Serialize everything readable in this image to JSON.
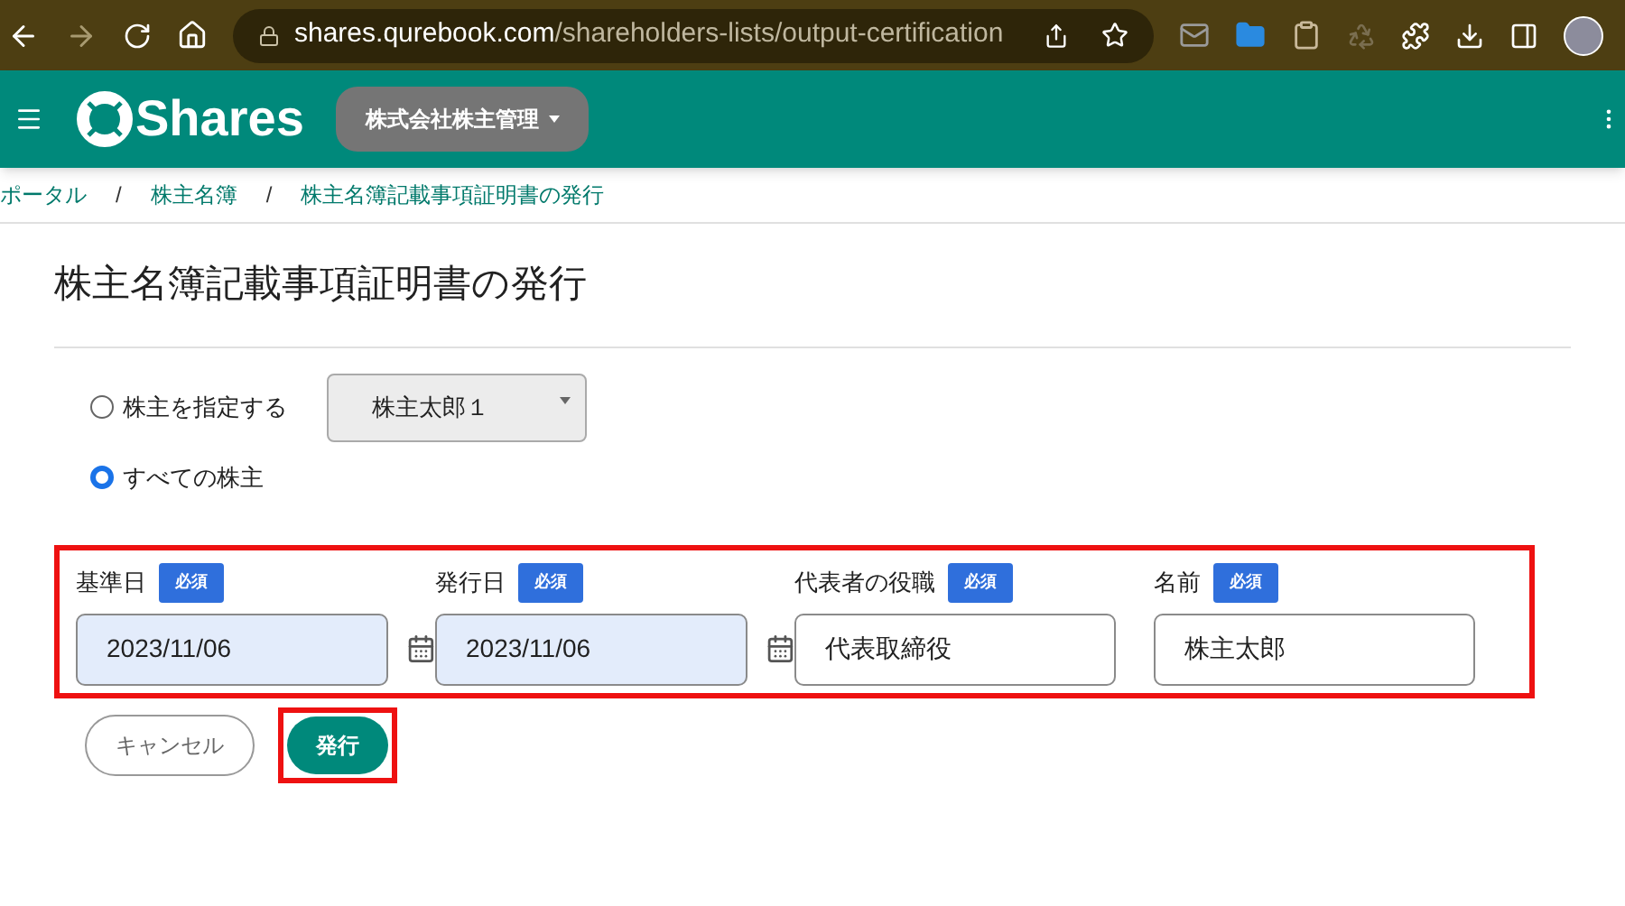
{
  "browser": {
    "url_host": "shares.qurebook.com",
    "url_path": "/shareholders-lists/output-certification"
  },
  "header": {
    "logo_text": "Shares",
    "company_menu": "株式会社株主管理"
  },
  "breadcrumb": [
    {
      "label": "ポータル"
    },
    {
      "label": "株主名簿"
    },
    {
      "label": "株主名簿記載事項証明書の発行"
    }
  ],
  "breadcrumb_separator": "/",
  "page_title": "株主名簿記載事項証明書の発行",
  "target_options": [
    {
      "label": "株主を指定する",
      "selected": false,
      "select_value": "株主太郎１"
    },
    {
      "label": "すべての株主",
      "selected": true
    }
  ],
  "fields_highlighted": true,
  "fields": [
    {
      "label": "基準日",
      "badge": "必須",
      "value": "2023/11/06",
      "kind": "date"
    },
    {
      "label": "発行日",
      "badge": "必須",
      "value": "2023/11/06",
      "kind": "date"
    },
    {
      "label": "代表者の役職",
      "badge": "必須",
      "value": "代表取締役",
      "kind": "text"
    },
    {
      "label": "名前",
      "badge": "必須",
      "value": "株主太郎",
      "kind": "text"
    }
  ],
  "buttons": [
    {
      "label": "キャンセル",
      "kind": "secondary",
      "highlighted": false
    },
    {
      "label": "発行",
      "kind": "primary",
      "highlighted": true
    }
  ]
}
